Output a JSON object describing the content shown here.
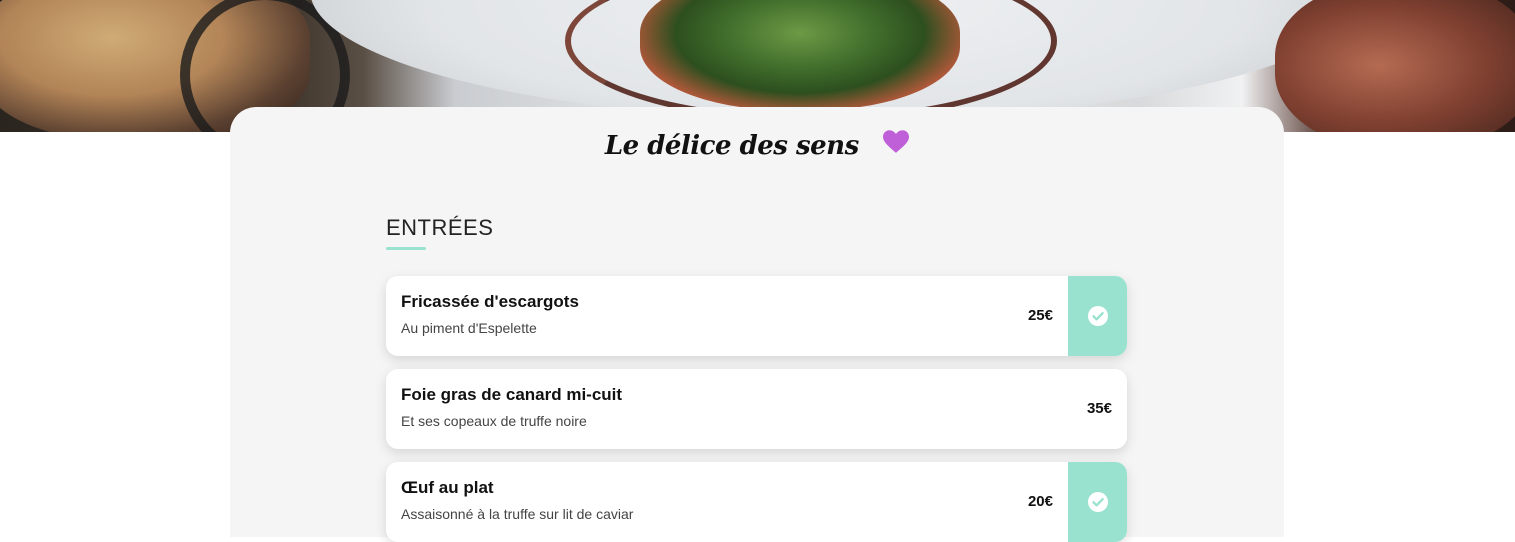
{
  "hero": {
    "image": "restaurant-dish-photo"
  },
  "brand": {
    "title": "Le délice des sens",
    "icon": "heart-icon",
    "icon_color": "#c060d8"
  },
  "menu": {
    "section_title": "ENTRÉES",
    "accent_color": "#99e2cf",
    "dishes": [
      {
        "name": "Fricassée d'escargots",
        "description": "Au piment d'Espelette",
        "price": "25€",
        "selected": true
      },
      {
        "name": "Foie gras de canard mi-cuit",
        "description": "Et ses copeaux de truffe noire",
        "price": "35€",
        "selected": false
      },
      {
        "name": "Œuf au plat",
        "description": "Assaisonné à la truffe sur lit de caviar",
        "price": "20€",
        "selected": true
      }
    ]
  }
}
